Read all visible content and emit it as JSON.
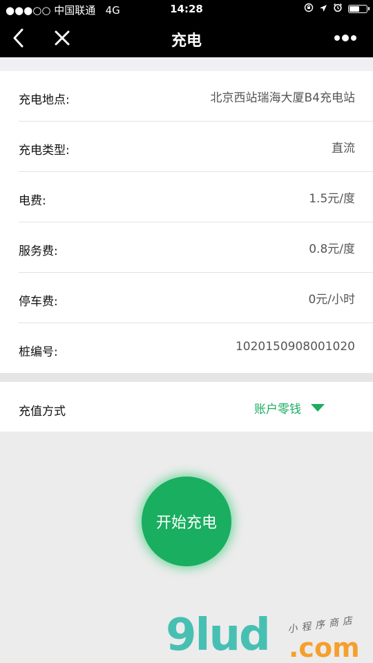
{
  "status_bar": {
    "signal": "●●●○○",
    "carrier": "中国联通",
    "network": "4G",
    "time": "14:28"
  },
  "nav": {
    "title": "充电"
  },
  "info_rows": [
    {
      "label": "充电地点:",
      "value": "北京西站瑞海大厦B4充电站"
    },
    {
      "label": "充电类型:",
      "value": "直流"
    },
    {
      "label": "电费:",
      "value": "1.5元/度"
    },
    {
      "label": "服务费:",
      "value": "0.8元/度"
    },
    {
      "label": "停车费:",
      "value": "0元/小时"
    },
    {
      "label": "桩编号:",
      "value": "1020150908001020"
    }
  ],
  "payment": {
    "label": "充值方式",
    "selected": "账户零钱"
  },
  "start_button": {
    "label": "开始充电"
  },
  "watermark": {
    "brand": "9lud",
    "tld": ".com",
    "tagline": "小程序商店"
  },
  "colors": {
    "accent": "#1aad5f",
    "nav_bg": "#000000"
  }
}
